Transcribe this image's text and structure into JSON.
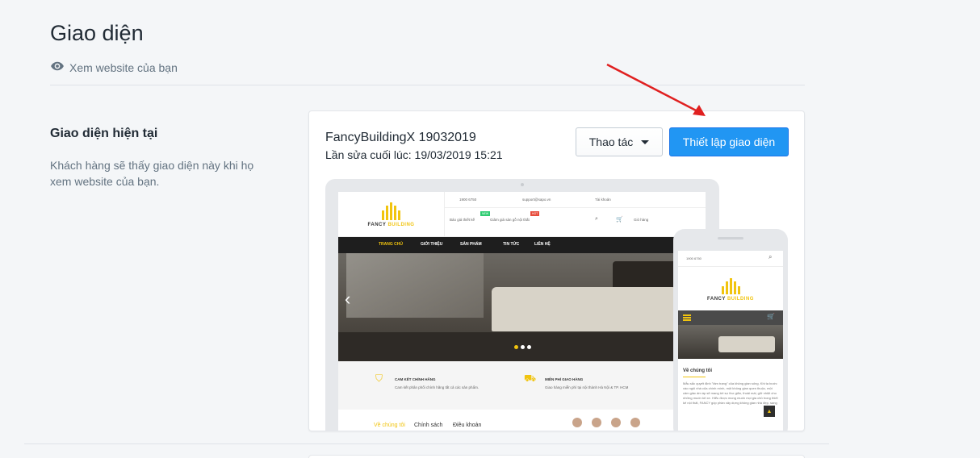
{
  "page": {
    "title": "Giao diện",
    "view_link": "Xem website của bạn"
  },
  "section": {
    "title": "Giao diện hiện tại",
    "description": "Khách hàng sẽ thấy giao diện này khi họ xem website của bạn."
  },
  "theme": {
    "name": "FancyBuildingX 19032019",
    "last_edited": "Lần sửa cuối lúc: 19/03/2019 15:21",
    "actions_label": "Thao tác",
    "customize_label": "Thiết lập giao diện"
  },
  "preview": {
    "logo_text_1": "FANCY",
    "logo_text_2": "BUILDING",
    "hotline": "1900 6750",
    "email": "support@sapo.vn",
    "account": "Tài khoản",
    "quote": "Báo giá thiết kế",
    "discount": "Giảm giá sàn gỗ nội thất",
    "badge_new": "NEW",
    "badge_hot": "HOT",
    "cart": "Giỏ hàng",
    "nav": [
      "TRANG CHỦ",
      "GIỚI THIỆU",
      "SẢN PHẨM",
      "TIN TỨC",
      "LIÊN HỆ"
    ],
    "feature_1_title": "CAM KẾT CHÍNH HÃNG",
    "feature_1_desc": "Cam kết phân phối chính hãng tất cả các sản phẩm.",
    "feature_2_title": "MIỄN PHÍ GIAO HÀNG",
    "feature_2_desc": "Giao hàng miễn phí tại nội thành Hà Nội & TP. HCM",
    "tabs": [
      "Về chúng tôi",
      "Chính sách",
      "Điều khoản"
    ],
    "mobile_hotline": "1900 6750",
    "mobile_about_title": "Về chúng tôi",
    "mobile_about": "Mẫu sắc quyết định \"tâm trạng\" của không gian sống. Khi ta bước vào ngôi nhà của chính mình, một không gian quen thuộc, một cảm giác ấm áp sẽ mang tới sự thư giãn, thoải mái, giữ nhiệt cho những muốn tới xe. Hiểu được mong muốn mọi gia chủ trong thiết kế nội thất, FANCY góp phần xây dựng không gian nhà đẹp, sang"
  },
  "colors": {
    "primary": "#2196f3",
    "brand_yellow": "#f1c40f",
    "annotation_arrow": "#e02020"
  }
}
